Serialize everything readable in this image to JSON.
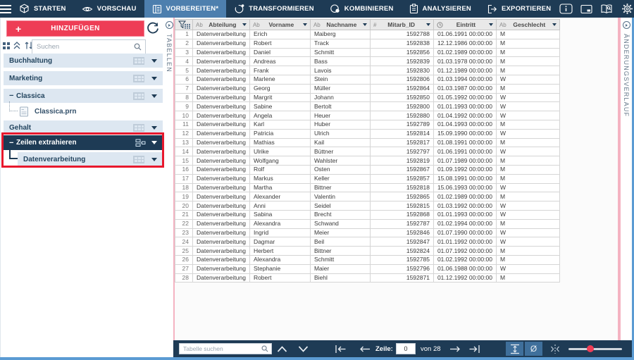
{
  "topnav": {
    "tabs": [
      {
        "label": "STARTEN",
        "icon": "cube-icon",
        "active": false
      },
      {
        "label": "VORSCHAU",
        "icon": "eye-icon",
        "active": false
      },
      {
        "label": "VORBEREITEN*",
        "icon": "prepare-table-icon",
        "active": true
      },
      {
        "label": "TRANSFORMIEREN",
        "icon": "transform-icon",
        "active": false
      },
      {
        "label": "KOMBINIEREN",
        "icon": "combine-icon",
        "active": false
      },
      {
        "label": "ANALYSIEREN",
        "icon": "analyze-icon",
        "active": false
      },
      {
        "label": "EXPORTIEREN",
        "icon": "export-icon",
        "active": false
      }
    ],
    "right_icons": [
      "info-icon",
      "window-icon",
      "help-book-icon",
      "settings-gear-icon"
    ]
  },
  "sidebar": {
    "add_button_label": "HINZUFÜGEN",
    "search_placeholder": "Suchen",
    "items": [
      {
        "label": "Buchhaltung"
      },
      {
        "label": "Marketing"
      },
      {
        "label": "Classica"
      },
      {
        "label": "Classica.prn"
      },
      {
        "label": "Gehalt"
      },
      {
        "label": "Zeilen extrahieren"
      },
      {
        "label": "Datenverarbeitung"
      }
    ]
  },
  "left_strip": {
    "label": "TABELLEN"
  },
  "right_strip": {
    "label": "ÄNDERUNGSVERLAUF"
  },
  "table": {
    "columns": [
      {
        "type": "Ab",
        "label": "Abteilung"
      },
      {
        "type": "Ab",
        "label": "Vorname"
      },
      {
        "type": "Ab",
        "label": "Nachname"
      },
      {
        "type": "#",
        "label": "Mitarb_ID"
      },
      {
        "type": "clock",
        "label": "Eintritt"
      },
      {
        "type": "Ab",
        "label": "Geschlecht"
      }
    ],
    "rows": [
      [
        "1",
        "Datenverarbeitung",
        "Erich",
        "Maiberg",
        "1592788",
        "01.06.1991 00:00:00",
        "M"
      ],
      [
        "2",
        "Datenverarbeitung",
        "Robert",
        "Track",
        "1592838",
        "12.12.1986 00:00:00",
        "M"
      ],
      [
        "3",
        "Datenverarbeitung",
        "Daniel",
        "Schmitt",
        "1592856",
        "01.02.1989 00:00:00",
        "M"
      ],
      [
        "4",
        "Datenverarbeitung",
        "Andreas",
        "Bass",
        "1592839",
        "01.03.1978 00:00:00",
        "M"
      ],
      [
        "5",
        "Datenverarbeitung",
        "Frank",
        "Lavois",
        "1592830",
        "01.12.1989 00:00:00",
        "M"
      ],
      [
        "6",
        "Datenverarbeitung",
        "Marlene",
        "Stein",
        "1592806",
        "01.03.1994 00:00:00",
        "W"
      ],
      [
        "7",
        "Datenverarbeitung",
        "Georg",
        "Müller",
        "1592864",
        "01.03.1987 00:00:00",
        "M"
      ],
      [
        "8",
        "Datenverarbeitung",
        "Margrit",
        "Johann",
        "1592850",
        "01.05.1992 00:00:00",
        "W"
      ],
      [
        "9",
        "Datenverarbeitung",
        "Sabine",
        "Bertolt",
        "1592800",
        "01.01.1993 00:00:00",
        "W"
      ],
      [
        "10",
        "Datenverarbeitung",
        "Angela",
        "Heuer",
        "1592880",
        "01.04.1992 00:00:00",
        "W"
      ],
      [
        "11",
        "Datenverarbeitung",
        "Karl",
        "Huber",
        "1592789",
        "01.04.1993 00:00:00",
        "M"
      ],
      [
        "12",
        "Datenverarbeitung",
        "Patricia",
        "Ulrich",
        "1592814",
        "15.09.1990 00:00:00",
        "W"
      ],
      [
        "13",
        "Datenverarbeitung",
        "Mathias",
        "Kail",
        "1592817",
        "01.08.1991 00:00:00",
        "M"
      ],
      [
        "14",
        "Datenverarbeitung",
        "Ulrike",
        "Büttner",
        "1592797",
        "01.06.1991 00:00:00",
        "W"
      ],
      [
        "15",
        "Datenverarbeitung",
        "Wolfgang",
        "Wahlster",
        "1592819",
        "01.07.1989 00:00:00",
        "M"
      ],
      [
        "16",
        "Datenverarbeitung",
        "Rolf",
        "Osten",
        "1592867",
        "01.09.1992 00:00:00",
        "M"
      ],
      [
        "17",
        "Datenverarbeitung",
        "Markus",
        "Keller",
        "1592857",
        "15.08.1991 00:00:00",
        "M"
      ],
      [
        "18",
        "Datenverarbeitung",
        "Martha",
        "Bittner",
        "1592818",
        "15.06.1993 00:00:00",
        "W"
      ],
      [
        "19",
        "Datenverarbeitung",
        "Alexander",
        "Valentin",
        "1592865",
        "01.02.1989 00:00:00",
        "M"
      ],
      [
        "20",
        "Datenverarbeitung",
        "Anni",
        "Seidel",
        "1592815",
        "01.03.1992 00:00:00",
        "W"
      ],
      [
        "21",
        "Datenverarbeitung",
        "Sabina",
        "Brecht",
        "1592868",
        "01.01.1993 00:00:00",
        "W"
      ],
      [
        "22",
        "Datenverarbeitung",
        "Alexandra",
        "Schwand",
        "1592787",
        "01.02.1994 00:00:00",
        "M"
      ],
      [
        "23",
        "Datenverarbeitung",
        "Ingrid",
        "Meier",
        "1592846",
        "01.07.1990 00:00:00",
        "W"
      ],
      [
        "24",
        "Datenverarbeitung",
        "Dagmar",
        "Beil",
        "1592847",
        "01.01.1992 00:00:00",
        "W"
      ],
      [
        "25",
        "Datenverarbeitung",
        "Herbert",
        "Bittner",
        "1592824",
        "01.07.1992 00:00:00",
        "M"
      ],
      [
        "26",
        "Datenverarbeitung",
        "Alexandra",
        "Schmitt",
        "1592785",
        "01.02.1992 00:00:00",
        "M"
      ],
      [
        "27",
        "Datenverarbeitung",
        "Stephanie",
        "Maier",
        "1592796",
        "01.06.1988 00:00:00",
        "W"
      ],
      [
        "28",
        "Datenverarbeitung",
        "Robert",
        "Biehl",
        "1592871",
        "01.12.1992 00:00:00",
        "M"
      ]
    ]
  },
  "statusbar": {
    "search_placeholder": "Tabelle suchen",
    "row_label": "Zeile:",
    "row_value": "0",
    "of_label": "von 28",
    "null_icon": "Ø"
  },
  "colors": {
    "navy": "#1e3b55",
    "active_tab": "#4d7fae",
    "accent_pink": "#ee3d56",
    "annotation_red": "#e8182d",
    "item_bg": "#dde7f1",
    "panel_border_pink": "#f4b3c2",
    "window_border": "#5b9bd3"
  }
}
